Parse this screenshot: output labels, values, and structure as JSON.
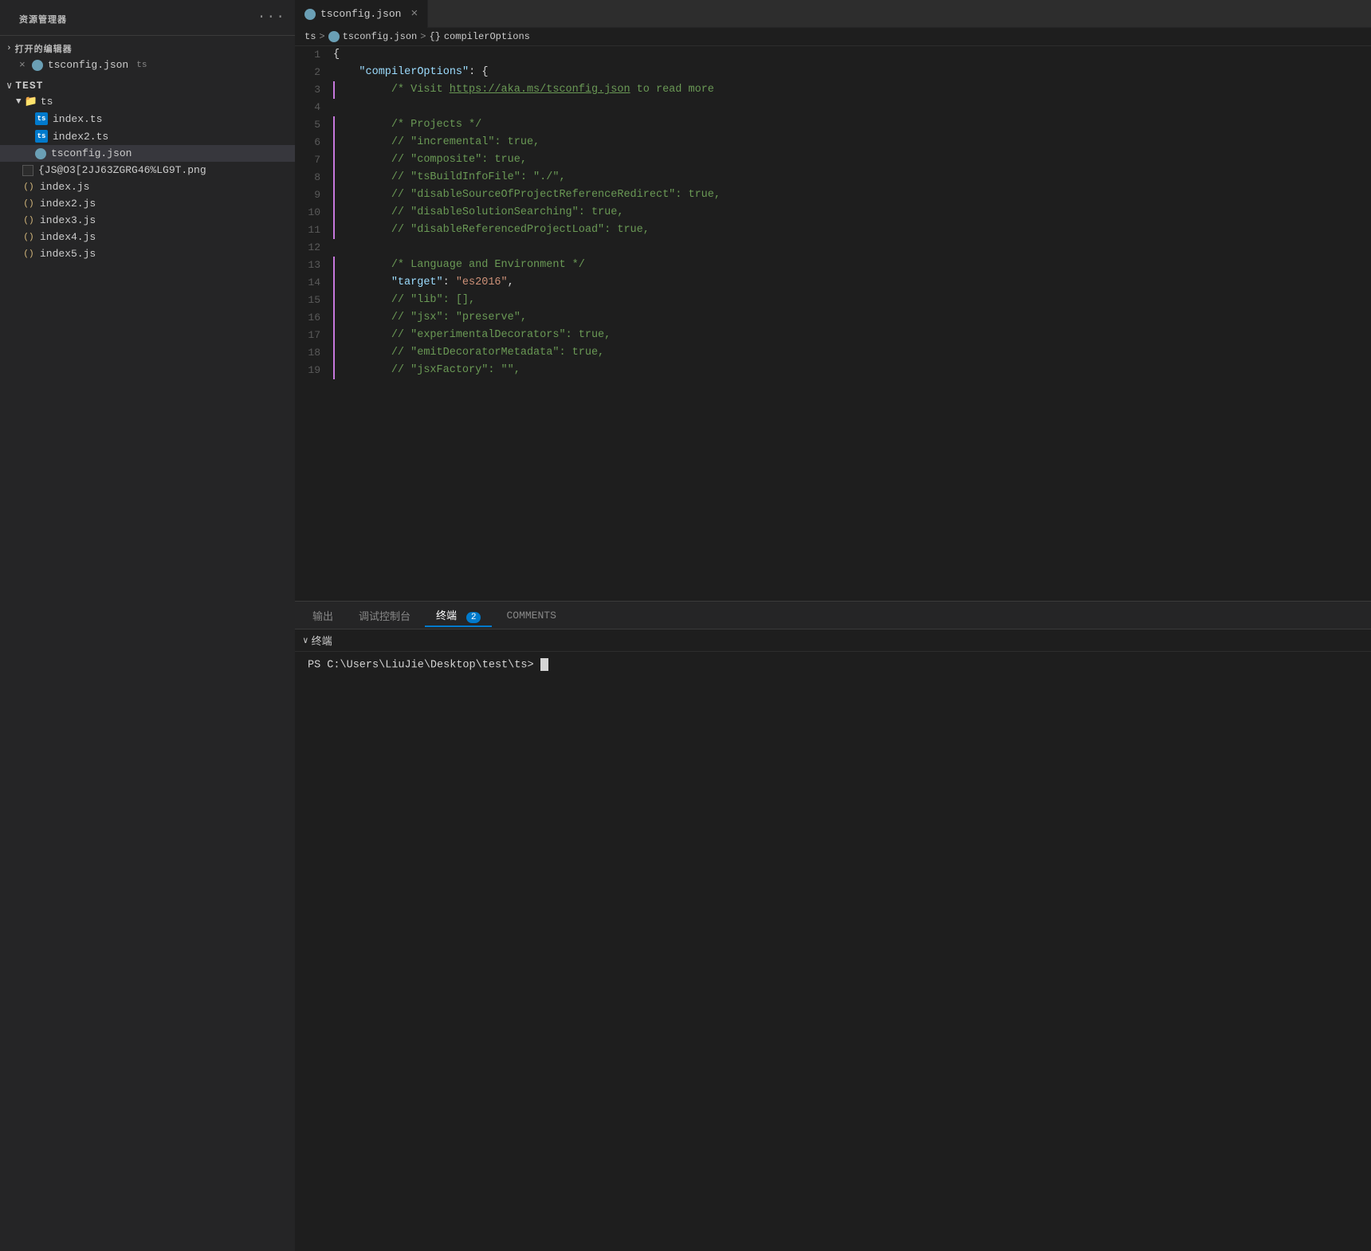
{
  "sidebar": {
    "title": "资源管理器",
    "more_icon": "···",
    "open_editors_label": "打开的编辑器",
    "open_files": [
      {
        "name": "tsconfig.json",
        "lang": "ts",
        "type": "json"
      }
    ],
    "workspace": {
      "name": "TEST",
      "folders": [
        {
          "name": "ts",
          "type": "folder",
          "children": [
            {
              "name": "index.ts",
              "type": "ts"
            },
            {
              "name": "index2.ts",
              "type": "ts"
            },
            {
              "name": "tsconfig.json",
              "type": "json",
              "active": true
            }
          ]
        },
        {
          "name": "{JS@O3[2JJ63ZGRG46%LG9T.png",
          "type": "png"
        },
        {
          "name": "index.js",
          "type": "js"
        },
        {
          "name": "index2.js",
          "type": "js"
        },
        {
          "name": "index3.js",
          "type": "js"
        },
        {
          "name": "index4.js",
          "type": "js"
        },
        {
          "name": "index5.js",
          "type": "js"
        }
      ]
    }
  },
  "tab": {
    "filename": "tsconfig.json",
    "close_label": "×"
  },
  "breadcrumb": {
    "ts": "ts",
    "sep1": ">",
    "file": "tsconfig.json",
    "sep2": ">",
    "braces": "{}",
    "section": "compilerOptions"
  },
  "code": {
    "lines": [
      {
        "num": "1",
        "content": "{"
      },
      {
        "num": "2",
        "content": "    \"compilerOptions\": {"
      },
      {
        "num": "3",
        "content": "        /* Visit https://aka.ms/tsconfig.json to read more"
      },
      {
        "num": "4",
        "content": ""
      },
      {
        "num": "5",
        "content": "        /* Projects */"
      },
      {
        "num": "6",
        "content": "        // \"incremental\": true,"
      },
      {
        "num": "7",
        "content": "        // \"composite\": true,"
      },
      {
        "num": "8",
        "content": "        // \"tsBuildInfoFile\": \"./\","
      },
      {
        "num": "9",
        "content": "        // \"disableSourceOfProjectReferenceRedirect\": true,"
      },
      {
        "num": "10",
        "content": "        // \"disableSolutionSearching\": true,"
      },
      {
        "num": "11",
        "content": "        // \"disableReferencedProjectLoad\": true,"
      },
      {
        "num": "12",
        "content": ""
      },
      {
        "num": "13",
        "content": "        /* Language and Environment */"
      },
      {
        "num": "14",
        "content": "        \"target\": \"es2016\","
      },
      {
        "num": "15",
        "content": "        // \"lib\": [],"
      },
      {
        "num": "16",
        "content": "        // \"jsx\": \"preserve\","
      },
      {
        "num": "17",
        "content": "        // \"experimentalDecorators\": true,"
      },
      {
        "num": "18",
        "content": "        // \"emitDecoratorMetadata\": true,"
      },
      {
        "num": "19",
        "content": "        // \"jsxFactory\": \"\","
      }
    ]
  },
  "terminal": {
    "tabs": [
      {
        "label": "输出",
        "active": false
      },
      {
        "label": "调试控制台",
        "active": false
      },
      {
        "label": "终端",
        "active": true,
        "badge": "2"
      },
      {
        "label": "COMMENTS",
        "active": false
      }
    ],
    "section_header": "终端",
    "prompt": "PS C:\\Users\\LiuJie\\Desktop\\test\\ts> "
  }
}
